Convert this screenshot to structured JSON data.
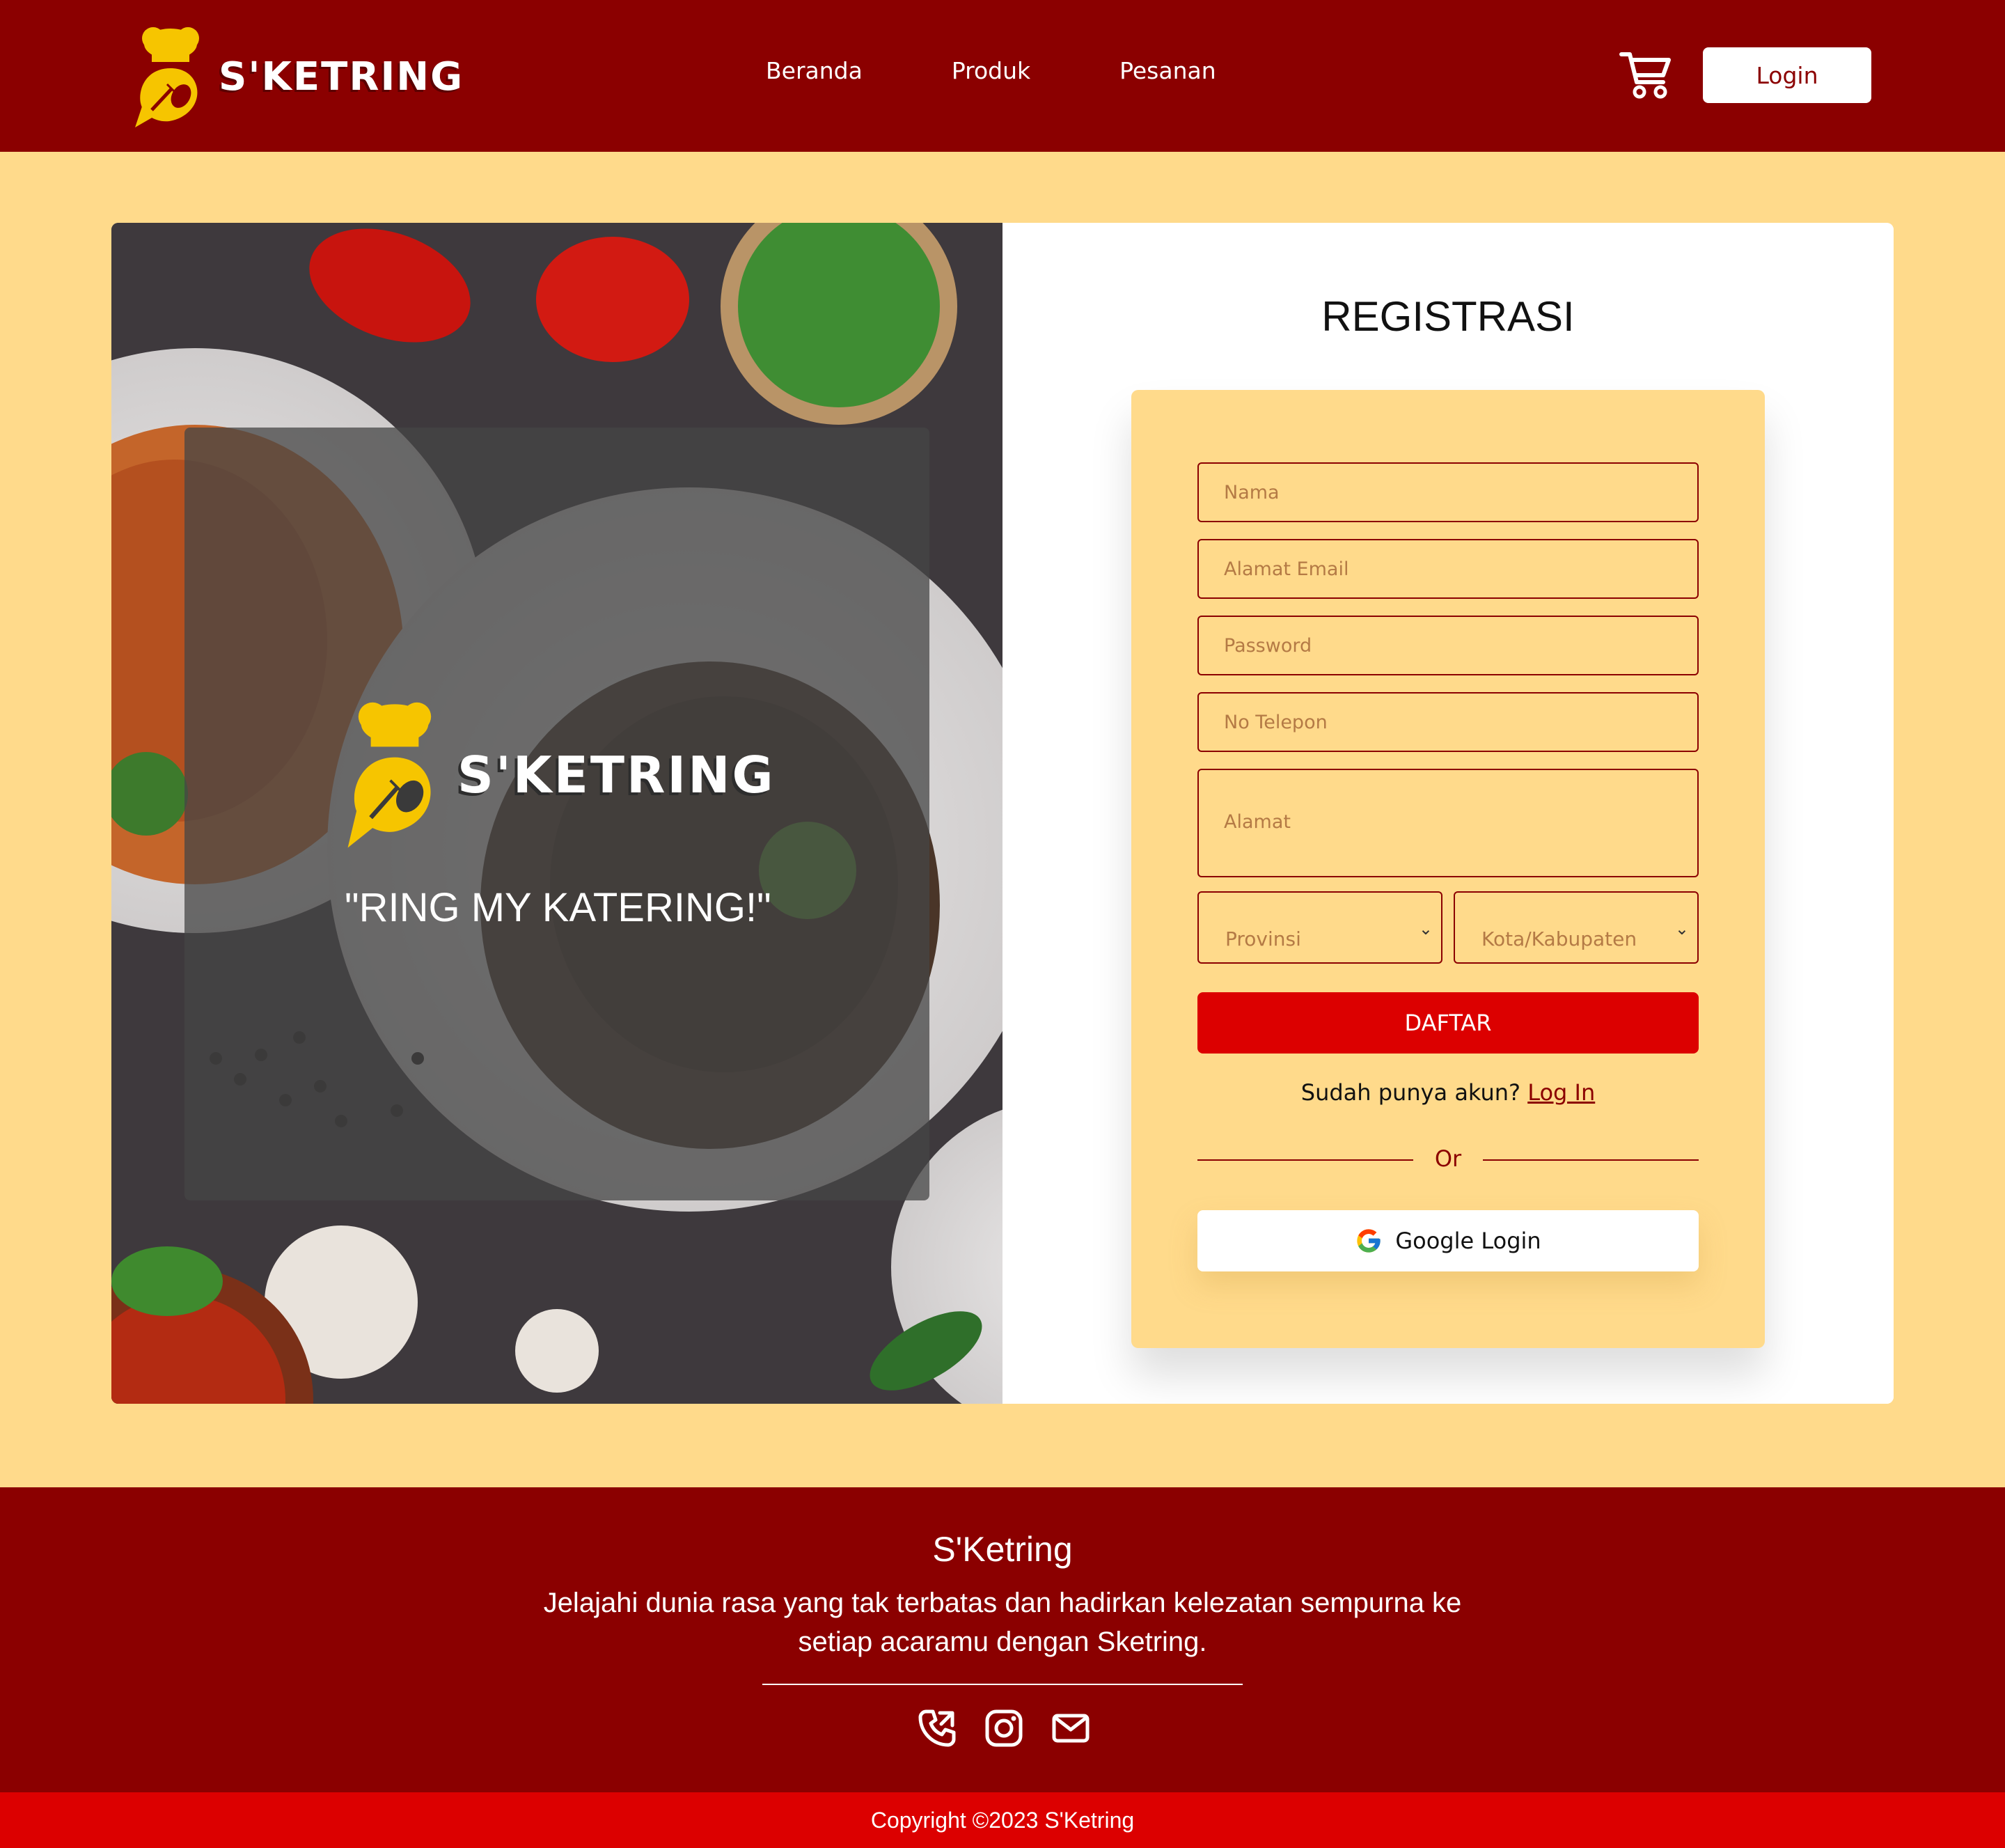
{
  "navbar": {
    "brand": "S'KETRING",
    "links": [
      "Beranda",
      "Produk",
      "Pesanan"
    ],
    "login_label": "Login"
  },
  "hero": {
    "brand": "S'KETRING",
    "slogan": "\"RING MY KATERING!\""
  },
  "form": {
    "title": "REGISTRASI",
    "placeholders": {
      "name": "Nama",
      "email": "Alamat Email",
      "password": "Password",
      "phone": "No Telepon",
      "address": "Alamat"
    },
    "province": "Provinsi",
    "city": "Kota/Kabupaten",
    "submit_label": "DAFTAR",
    "already_text": "Sudah punya akun? ",
    "login_link": "Log In",
    "or_text": "Or",
    "google_label": "Google Login"
  },
  "footer": {
    "title": "S'Ketring",
    "description": "Jelajahi dunia rasa yang tak terbatas dan hadirkan kelezatan sempurna ke setiap acaramu dengan Sketring.",
    "social_icons": [
      "phone-icon",
      "instagram-icon",
      "mail-icon"
    ],
    "copyright": "Copyright ©2023 S'Ketring"
  },
  "colors": {
    "primary": "#8b0000",
    "accent": "#dc0000",
    "background": "#ffda8b"
  }
}
